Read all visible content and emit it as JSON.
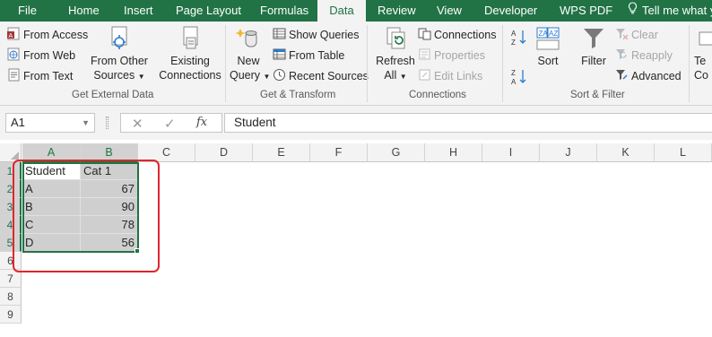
{
  "tabs": [
    "File",
    "Home",
    "Insert",
    "Page Layout",
    "Formulas",
    "Data",
    "Review",
    "View",
    "Developer",
    "WPS PDF"
  ],
  "tell_me": "Tell me what y",
  "get_external": {
    "from_access": "From Access",
    "from_web": "From Web",
    "from_text": "From Text",
    "from_other_1": "From Other",
    "from_other_2": "Sources",
    "existing_1": "Existing",
    "existing_2": "Connections",
    "label": "Get External Data"
  },
  "get_transform": {
    "new_query_1": "New",
    "new_query_2": "Query",
    "show_queries": "Show Queries",
    "from_table": "From Table",
    "recent_sources": "Recent Sources",
    "label": "Get & Transform"
  },
  "connections": {
    "refresh_1": "Refresh",
    "refresh_2": "All",
    "connections": "Connections",
    "properties": "Properties",
    "edit_links": "Edit Links",
    "label": "Connections"
  },
  "sort_filter": {
    "sort": "Sort",
    "filter": "Filter",
    "clear": "Clear",
    "reapply": "Reapply",
    "advanced": "Advanced",
    "label": "Sort & Filter"
  },
  "cut_off": {
    "line1": "Te",
    "line2": "Co"
  },
  "formula_bar": {
    "name_box": "A1",
    "fx": "fx",
    "value": "Student"
  },
  "columns": [
    "A",
    "B",
    "C",
    "D",
    "E",
    "F",
    "G",
    "H",
    "I",
    "J",
    "K",
    "L"
  ],
  "rows": [
    "1",
    "2",
    "3",
    "4",
    "5",
    "6",
    "7",
    "8",
    "9"
  ],
  "sheet": {
    "cells": [
      [
        "Student",
        "Cat 1"
      ],
      [
        "A",
        "67"
      ],
      [
        "B",
        "90"
      ],
      [
        "C",
        "78"
      ],
      [
        "D",
        "56"
      ]
    ]
  },
  "colors": {
    "brand": "#217346",
    "highlight_box": "#e0262b"
  }
}
